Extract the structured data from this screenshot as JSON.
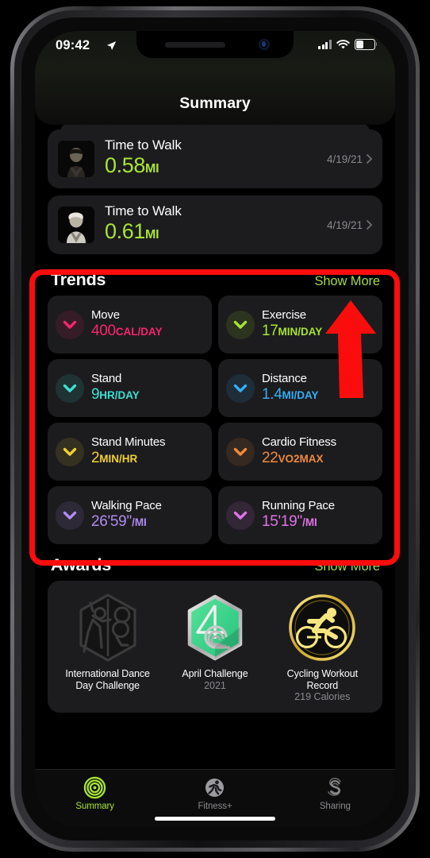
{
  "status_bar": {
    "time": "09:42",
    "location_icon": "location-arrow-icon",
    "signal_icon": "cellular-signal-icon",
    "wifi_icon": "wifi-icon",
    "battery_icon": "battery-icon"
  },
  "nav": {
    "title": "Summary"
  },
  "time_to_walk": [
    {
      "title": "Time to Walk",
      "value": "0.58",
      "unit": "MI",
      "date": "4/19/21",
      "thumb": "person-portrait-thumbnail"
    },
    {
      "title": "Time to Walk",
      "value": "0.61",
      "unit": "MI",
      "date": "4/19/21",
      "thumb": "person-portrait-thumbnail"
    }
  ],
  "trends": {
    "title": "Trends",
    "show_more": "Show More",
    "items": [
      {
        "name": "Move",
        "value": "400",
        "unit": "CAL/DAY",
        "color": "#f8256b",
        "icon": "chevron-down-icon"
      },
      {
        "name": "Exercise",
        "value": "17",
        "unit": "MIN/DAY",
        "color": "#a8e533",
        "icon": "chevron-down-icon"
      },
      {
        "name": "Stand",
        "value": "9",
        "unit": "HR/DAY",
        "color": "#3ce0d4",
        "icon": "chevron-down-icon"
      },
      {
        "name": "Distance",
        "value": "1.4",
        "unit": "MI/DAY",
        "color": "#37aef5",
        "icon": "chevron-down-icon"
      },
      {
        "name": "Stand Minutes",
        "value": "2",
        "unit": "MIN/HR",
        "color": "#f0d033",
        "icon": "chevron-down-icon"
      },
      {
        "name": "Cardio Fitness",
        "value": "22",
        "unit": "VO2MAX",
        "color": "#f08a3c",
        "icon": "chevron-down-icon"
      },
      {
        "name": "Walking Pace",
        "value": "26'59''",
        "unit": "/MI",
        "color": "#b08cf0",
        "icon": "chevron-down-icon"
      },
      {
        "name": "Running Pace",
        "value": "15'19''",
        "unit": "/MI",
        "color": "#e173e8",
        "icon": "chevron-down-icon"
      }
    ]
  },
  "awards": {
    "title": "Awards",
    "show_more": "Show More",
    "items": [
      {
        "name": "International Dance\nDay Challenge",
        "sub": "",
        "icon": "dance-challenge-badge"
      },
      {
        "name": "April Challenge",
        "sub": "2021",
        "icon": "april-challenge-badge"
      },
      {
        "name": "Cycling Workout\nRecord",
        "sub": "219 Calories",
        "icon": "cycling-record-badge"
      }
    ]
  },
  "tabbar": {
    "tabs": [
      {
        "label": "Summary",
        "icon": "activity-rings-icon",
        "active": true
      },
      {
        "label": "Fitness+",
        "icon": "runner-icon",
        "active": false
      },
      {
        "label": "Sharing",
        "icon": "sharing-s-icon",
        "active": false
      }
    ]
  },
  "annotation": {
    "highlight_color": "#fc0d0d",
    "box_target": "trends-section",
    "arrow_target": "trends-show-more-button"
  }
}
